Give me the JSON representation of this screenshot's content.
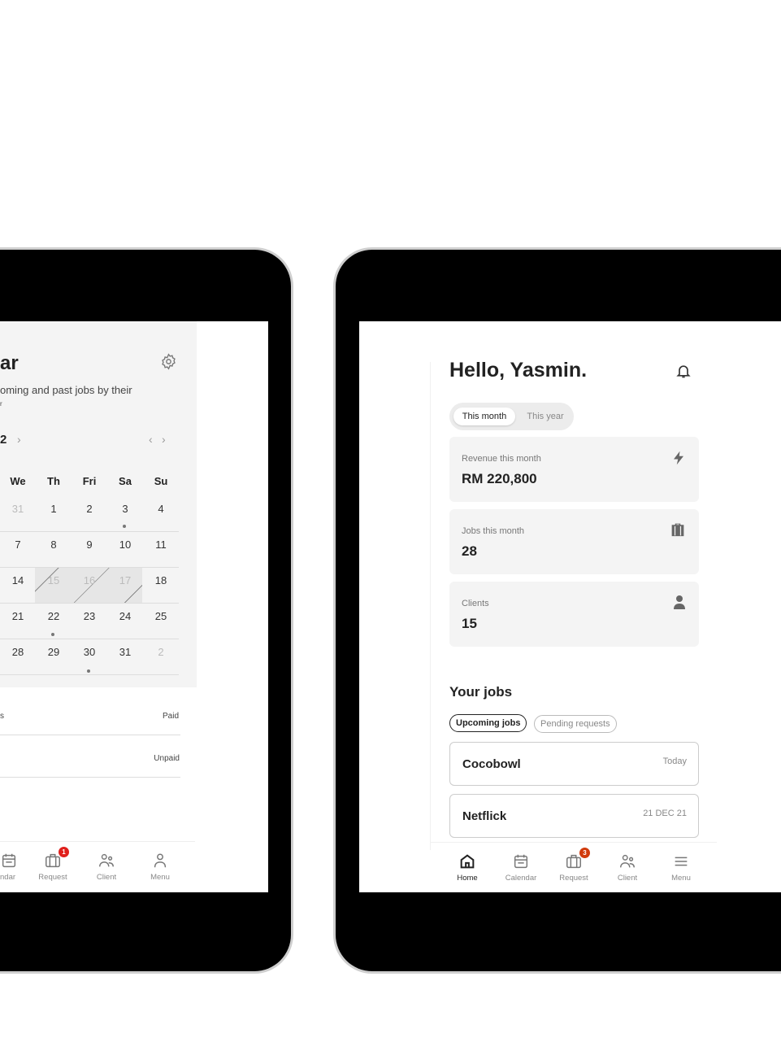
{
  "left_screen": {
    "title": "ar",
    "subtitle": "oming and past jobs by their",
    "subtitle2": "r",
    "month_fragment": "2",
    "weekdays": [
      "We",
      "Th",
      "Fri",
      "Sa",
      "Su"
    ],
    "weeks": [
      [
        "31",
        "1",
        "2",
        "3",
        "4"
      ],
      [
        "7",
        "8",
        "9",
        "10",
        "11"
      ],
      [
        "14",
        "15",
        "16",
        "17",
        "18"
      ],
      [
        "21",
        "22",
        "23",
        "24",
        "25"
      ],
      [
        "28",
        "29",
        "30",
        "31",
        "2"
      ]
    ],
    "list": [
      {
        "left": "s",
        "status": "Paid"
      },
      {
        "left": "",
        "status": "Unpaid"
      }
    ],
    "nav": [
      {
        "label": "ndar",
        "icon": "calendar-icon"
      },
      {
        "label": "Request",
        "icon": "briefcase-icon",
        "badge": "1"
      },
      {
        "label": "Client",
        "icon": "users-icon"
      },
      {
        "label": "Menu",
        "icon": "user-icon"
      }
    ],
    "badge_color": "#e0201c"
  },
  "right_screen": {
    "greeting": "Hello, Yasmin.",
    "period_tabs": [
      {
        "label": "This month",
        "active": true
      },
      {
        "label": "This year",
        "active": false
      }
    ],
    "stats": [
      {
        "label": "Revenue this month",
        "value": "RM 220,800",
        "icon": "lightning-icon"
      },
      {
        "label": "Jobs this month",
        "value": "28",
        "icon": "briefcase-icon"
      },
      {
        "label": "Clients",
        "value": "15",
        "icon": "person-icon"
      }
    ],
    "jobs_title": "Your jobs",
    "job_tabs": [
      {
        "label": "Upcoming jobs",
        "active": true
      },
      {
        "label": "Pending requests",
        "active": false
      }
    ],
    "jobs": [
      {
        "name": "Cocobowl",
        "date": "Today"
      },
      {
        "name": "Netflick",
        "date": "21 DEC 21"
      }
    ],
    "nav": [
      {
        "label": "Home",
        "icon": "home-icon",
        "active": true
      },
      {
        "label": "Calendar",
        "icon": "calendar-icon"
      },
      {
        "label": "Request",
        "icon": "briefcase-icon",
        "badge": "3"
      },
      {
        "label": "Client",
        "icon": "users-icon"
      },
      {
        "label": "Menu",
        "icon": "menu-icon"
      }
    ],
    "badge_color": "#d13b0c"
  }
}
